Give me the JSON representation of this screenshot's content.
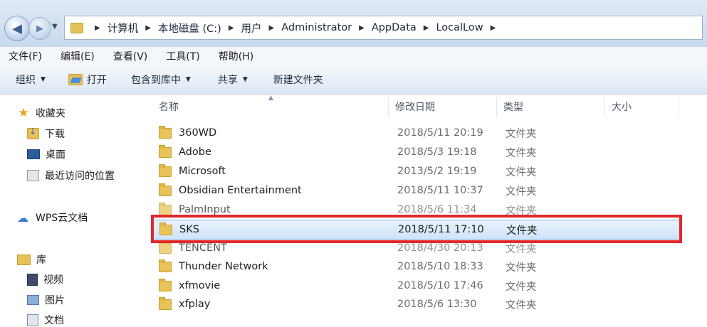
{
  "address": {
    "crumbs": [
      "计算机",
      "本地磁盘 (C:)",
      "用户",
      "Administrator",
      "AppData",
      "LocalLow"
    ]
  },
  "menubar": {
    "items": [
      "文件(F)",
      "编辑(E)",
      "查看(V)",
      "工具(T)",
      "帮助(H)"
    ]
  },
  "toolbar": {
    "organize": "组织",
    "open": "打开",
    "include_library": "包含到库中",
    "share": "共享",
    "new_folder": "新建文件夹"
  },
  "sidebar": {
    "favorites": "收藏夹",
    "downloads": "下载",
    "desktop": "桌面",
    "recent": "最近访问的位置",
    "wps": "WPS云文档",
    "libraries": "库",
    "videos": "视频",
    "pictures": "图片",
    "documents": "文档"
  },
  "columns": {
    "name": "名称",
    "modified": "修改日期",
    "type": "类型",
    "size": "大小"
  },
  "files": [
    {
      "name": "360WD",
      "modified": "2018/5/11 20:19",
      "type": "文件夹"
    },
    {
      "name": "Adobe",
      "modified": "2018/5/3 19:18",
      "type": "文件夹"
    },
    {
      "name": "Microsoft",
      "modified": "2013/5/2 19:19",
      "type": "文件夹"
    },
    {
      "name": "Obsidian Entertainment",
      "modified": "2018/5/11 10:37",
      "type": "文件夹"
    },
    {
      "name": "PalmInput",
      "modified": "2018/5/6 11:34",
      "type": "文件夹"
    },
    {
      "name": "SKS",
      "modified": "2018/5/11 17:10",
      "type": "文件夹",
      "selected": true
    },
    {
      "name": "TENCENT",
      "modified": "2018/4/30 20:13",
      "type": "文件夹"
    },
    {
      "name": "Thunder Network",
      "modified": "2018/5/10 18:33",
      "type": "文件夹"
    },
    {
      "name": "xfmovie",
      "modified": "2018/5/10 17:46",
      "type": "文件夹"
    },
    {
      "name": "xfplay",
      "modified": "2018/5/6 13:30",
      "type": "文件夹"
    }
  ],
  "colors": {
    "highlight_box": "#e0282b",
    "selection": "#cfe3fa",
    "folder": "#e8c35a"
  }
}
